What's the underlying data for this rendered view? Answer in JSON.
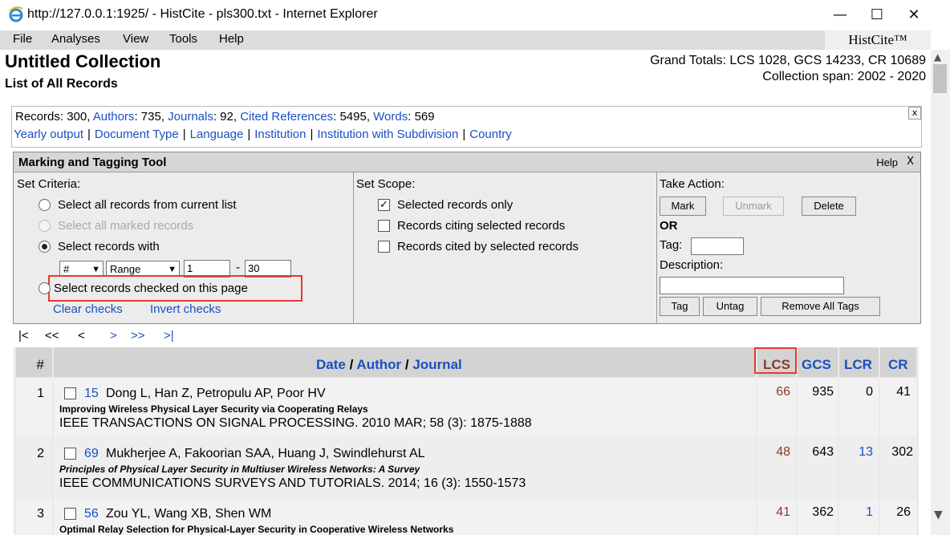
{
  "window": {
    "title": "http://127.0.0.1:1925/ - HistCite - pls300.txt - Internet Explorer",
    "minimize": "—",
    "maximize": "☐",
    "close": "✕"
  },
  "menu": {
    "items": [
      "File",
      "Analyses",
      "View",
      "Tools",
      "Help"
    ],
    "brand": "HistCite™"
  },
  "header": {
    "title": "Untitled Collection",
    "subtitle": "List of All Records",
    "grand_totals": "Grand Totals: LCS 1028, GCS 14233, CR 10689",
    "span": "Collection span: 2002 - 2020"
  },
  "stats": {
    "records_label": "Records: 300,",
    "authors_link": "Authors",
    "authors_val": ": 735,",
    "journals_link": "Journals",
    "journals_val": ": 92,",
    "cited_link": "Cited References",
    "cited_val": ": 5495,",
    "words_link": "Words",
    "words_val": ": 569",
    "links": [
      "Yearly output",
      "Document Type",
      "Language",
      "Institution",
      "Institution with Subdivision",
      "Country"
    ],
    "close": "x"
  },
  "tool": {
    "title": "Marking and Tagging Tool",
    "help": "Help",
    "close": "X",
    "criteria_label": "Set Criteria:",
    "opt1": "Select all records from current list",
    "opt2": "Select all marked records",
    "opt3": "Select records with",
    "opt4": "Select records checked on this page",
    "field_select": "#",
    "mode_select": "Range",
    "from": "1",
    "dash": "-",
    "to": "30",
    "clear_checks": "Clear checks",
    "invert_checks": "Invert checks",
    "scope_label": "Set Scope:",
    "scope1": "Selected records only",
    "scope2": "Records citing selected records",
    "scope3": "Records cited by selected records",
    "action_label": "Take Action:",
    "mark": "Mark",
    "unmark": "Unmark",
    "delete": "Delete",
    "or": "OR",
    "tag_label": "Tag:",
    "desc_label": "Description:",
    "tag_btn": "Tag",
    "untag_btn": "Untag",
    "remove_tags_btn": "Remove All Tags"
  },
  "pager": {
    "first": "|<",
    "prev_many": "<<",
    "prev": "<",
    "next": ">",
    "next_many": ">>",
    "last": ">|"
  },
  "table": {
    "col_num": "#",
    "col_date": "Date",
    "slash": "/",
    "col_author": "Author",
    "col_journal": "Journal",
    "col_lcs": "LCS",
    "col_gcs": "GCS",
    "col_lcr": "LCR",
    "col_cr": "CR",
    "rows": [
      {
        "num": "1",
        "id": "15",
        "authors": "Dong L, Han Z, Petropulu AP, Poor HV",
        "title": "Improving Wireless Physical Layer Security via Cooperating Relays",
        "source": "IEEE TRANSACTIONS ON SIGNAL PROCESSING. 2010 MAR; 58 (3): 1875-1888",
        "lcs": "66",
        "gcs": "935",
        "lcr": "0",
        "cr": "41"
      },
      {
        "num": "2",
        "id": "69",
        "authors": "Mukherjee A, Fakoorian SAA, Huang J, Swindlehurst AL",
        "title": "Principles of Physical Layer Security in Multiuser Wireless Networks: A Survey",
        "source": "IEEE COMMUNICATIONS SURVEYS AND TUTORIALS. 2014; 16 (3): 1550-1573",
        "lcs": "48",
        "gcs": "643",
        "lcr": "13",
        "cr": "302"
      },
      {
        "num": "3",
        "id": "56",
        "authors": "Zou YL, Wang XB, Shen WM",
        "title": "Optimal Relay Selection for Physical-Layer Security in Cooperative Wireless Networks",
        "source": "",
        "lcs": "41",
        "gcs": "362",
        "lcr": "1",
        "cr": "26"
      }
    ]
  },
  "colors": {
    "link": "#1a4fc2",
    "lcs": "#8b3a2e",
    "highlight": "#e53935"
  }
}
